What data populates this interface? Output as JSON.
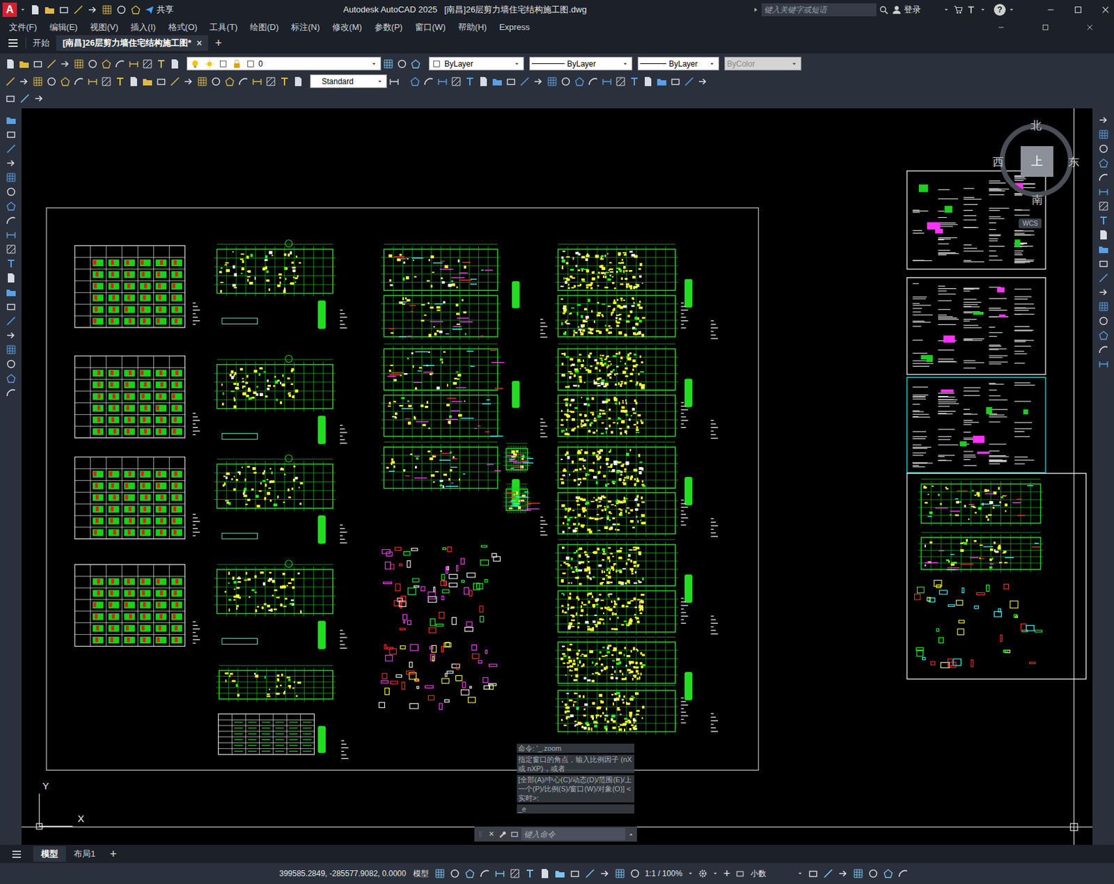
{
  "window": {
    "logo": "A",
    "title": "Autodesk AutoCAD 2025   [南昌]26层剪力墙住宅结构施工图.dwg",
    "share": "共享",
    "search": {
      "placeholder": "键入关键字或短语"
    },
    "login": "登录",
    "help": "?"
  },
  "menu": [
    "文件(F)",
    "编辑(E)",
    "视图(V)",
    "插入(I)",
    "格式(O)",
    "工具(T)",
    "绘图(D)",
    "标注(N)",
    "修改(M)",
    "参数(P)",
    "窗口(W)",
    "帮助(H)",
    "Express"
  ],
  "doc_tabs": [
    {
      "label": "开始",
      "selected": false
    },
    {
      "label": "[南昌]26层剪力墙住宅结构施工图*",
      "selected": true,
      "close": "×"
    }
  ],
  "new_tab": "+",
  "properties": {
    "layer": "0",
    "color": "ByLayer",
    "linetype": "ByLayer",
    "lineweight": "ByLayer",
    "plotstyle": {
      "label": "ByColor",
      "disabled": true
    }
  },
  "text_style": "Standard",
  "viewcube": {
    "north": "北",
    "west": "西",
    "east": "东",
    "south": "南",
    "face": "上",
    "ucs": "WCS"
  },
  "ucs_icon": {
    "y": "Y",
    "x": "X"
  },
  "command": {
    "history": [
      "命令: '_.zoom",
      "指定窗口的角点，输入比例因子 (nX 或 nXP)，或者",
      "[全部(A)/中心(C)/动态(D)/范围(E)/上一个(P)/比例(S)/窗口(W)/对象(O)] <实时>:",
      "_e"
    ],
    "close": "×",
    "placeholder": "键入命令"
  },
  "layout_tabs": [
    {
      "label": "模型",
      "selected": true
    },
    {
      "label": "布局1",
      "selected": false
    }
  ],
  "new_layout": "+",
  "status_bar": {
    "coordinates": "399585.2849, -285577.9082, 0.0000",
    "space": "模型",
    "scale": "1:1 / 100%",
    "plus": "+",
    "units": "小数"
  }
}
